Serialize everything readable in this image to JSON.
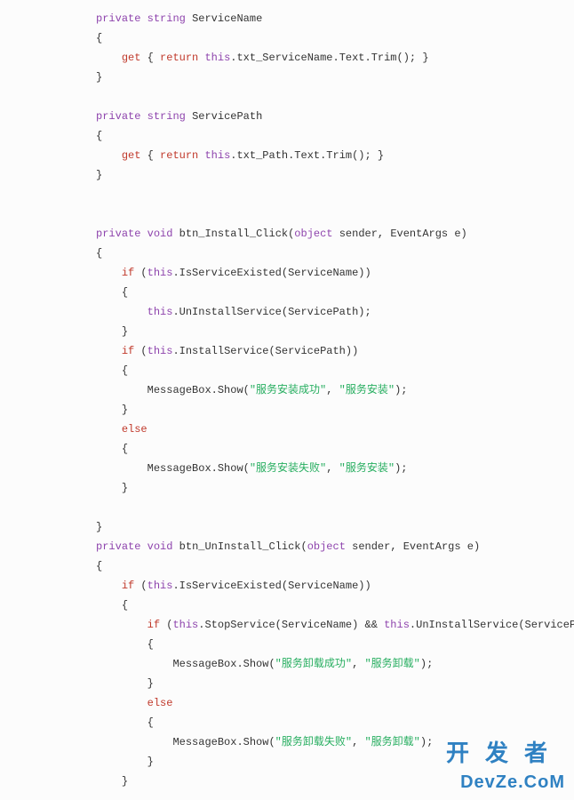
{
  "code": {
    "lines": [
      {
        "indent": 8,
        "tokens": [
          {
            "t": "private",
            "c": "kw"
          },
          {
            "t": " "
          },
          {
            "t": "string",
            "c": "kw"
          },
          {
            "t": " ServiceName"
          }
        ]
      },
      {
        "indent": 8,
        "tokens": [
          {
            "t": "{"
          }
        ]
      },
      {
        "indent": 12,
        "tokens": [
          {
            "t": "get",
            "c": "kw2"
          },
          {
            "t": " { "
          },
          {
            "t": "return",
            "c": "kw2"
          },
          {
            "t": " "
          },
          {
            "t": "this",
            "c": "kw"
          },
          {
            "t": ".txt_ServiceName.Text.Trim(); }"
          }
        ]
      },
      {
        "indent": 8,
        "tokens": [
          {
            "t": "}"
          }
        ]
      },
      {
        "indent": 8,
        "tokens": []
      },
      {
        "indent": 8,
        "tokens": [
          {
            "t": "private",
            "c": "kw"
          },
          {
            "t": " "
          },
          {
            "t": "string",
            "c": "kw"
          },
          {
            "t": " ServicePath"
          }
        ]
      },
      {
        "indent": 8,
        "tokens": [
          {
            "t": "{"
          }
        ]
      },
      {
        "indent": 12,
        "tokens": [
          {
            "t": "get",
            "c": "kw2"
          },
          {
            "t": " { "
          },
          {
            "t": "return",
            "c": "kw2"
          },
          {
            "t": " "
          },
          {
            "t": "this",
            "c": "kw"
          },
          {
            "t": ".txt_Path.Text.Trim(); }"
          }
        ]
      },
      {
        "indent": 8,
        "tokens": [
          {
            "t": "}"
          }
        ]
      },
      {
        "indent": 8,
        "tokens": []
      },
      {
        "indent": 8,
        "tokens": []
      },
      {
        "indent": 8,
        "tokens": [
          {
            "t": "private",
            "c": "kw"
          },
          {
            "t": " "
          },
          {
            "t": "void",
            "c": "kw"
          },
          {
            "t": " btn_Install_Click("
          },
          {
            "t": "object",
            "c": "kw"
          },
          {
            "t": " sender, EventArgs e)"
          }
        ]
      },
      {
        "indent": 8,
        "tokens": [
          {
            "t": "{"
          }
        ]
      },
      {
        "indent": 12,
        "tokens": [
          {
            "t": "if",
            "c": "kw2"
          },
          {
            "t": " ("
          },
          {
            "t": "this",
            "c": "kw"
          },
          {
            "t": ".IsServiceExisted(ServiceName))"
          }
        ]
      },
      {
        "indent": 12,
        "tokens": [
          {
            "t": "{"
          }
        ]
      },
      {
        "indent": 16,
        "tokens": [
          {
            "t": "this",
            "c": "kw"
          },
          {
            "t": ".UnInstallService(ServicePath);"
          }
        ]
      },
      {
        "indent": 12,
        "tokens": [
          {
            "t": "}"
          }
        ]
      },
      {
        "indent": 12,
        "tokens": [
          {
            "t": "if",
            "c": "kw2"
          },
          {
            "t": " ("
          },
          {
            "t": "this",
            "c": "kw"
          },
          {
            "t": ".InstallService(ServicePath))"
          }
        ]
      },
      {
        "indent": 12,
        "tokens": [
          {
            "t": "{"
          }
        ]
      },
      {
        "indent": 16,
        "tokens": [
          {
            "t": "MessageBox.Show("
          },
          {
            "t": "\"服务安装成功\"",
            "c": "str"
          },
          {
            "t": ", "
          },
          {
            "t": "\"服务安装\"",
            "c": "str"
          },
          {
            "t": ");"
          }
        ]
      },
      {
        "indent": 12,
        "tokens": [
          {
            "t": "}"
          }
        ]
      },
      {
        "indent": 12,
        "tokens": [
          {
            "t": "else",
            "c": "kw2"
          }
        ]
      },
      {
        "indent": 12,
        "tokens": [
          {
            "t": "{"
          }
        ]
      },
      {
        "indent": 16,
        "tokens": [
          {
            "t": "MessageBox.Show("
          },
          {
            "t": "\"服务安装失败\"",
            "c": "str"
          },
          {
            "t": ", "
          },
          {
            "t": "\"服务安装\"",
            "c": "str"
          },
          {
            "t": ");"
          }
        ]
      },
      {
        "indent": 12,
        "tokens": [
          {
            "t": "}"
          }
        ]
      },
      {
        "indent": 12,
        "tokens": []
      },
      {
        "indent": 8,
        "tokens": [
          {
            "t": "}"
          }
        ]
      },
      {
        "indent": 8,
        "tokens": [
          {
            "t": "private",
            "c": "kw"
          },
          {
            "t": " "
          },
          {
            "t": "void",
            "c": "kw"
          },
          {
            "t": " btn_UnInstall_Click("
          },
          {
            "t": "object",
            "c": "kw"
          },
          {
            "t": " sender, EventArgs e)"
          }
        ]
      },
      {
        "indent": 8,
        "tokens": [
          {
            "t": "{"
          }
        ]
      },
      {
        "indent": 12,
        "tokens": [
          {
            "t": "if",
            "c": "kw2"
          },
          {
            "t": " ("
          },
          {
            "t": "this",
            "c": "kw"
          },
          {
            "t": ".IsServiceExisted(ServiceName))"
          }
        ]
      },
      {
        "indent": 12,
        "tokens": [
          {
            "t": "{"
          }
        ]
      },
      {
        "indent": 16,
        "tokens": [
          {
            "t": "if",
            "c": "kw2"
          },
          {
            "t": " ("
          },
          {
            "t": "this",
            "c": "kw"
          },
          {
            "t": ".StopService(ServiceName) && "
          },
          {
            "t": "this",
            "c": "kw"
          },
          {
            "t": ".UnInstallService(ServicePath))"
          }
        ]
      },
      {
        "indent": 16,
        "tokens": [
          {
            "t": "{"
          }
        ]
      },
      {
        "indent": 20,
        "tokens": [
          {
            "t": "MessageBox.Show("
          },
          {
            "t": "\"服务卸载成功\"",
            "c": "str"
          },
          {
            "t": ", "
          },
          {
            "t": "\"服务卸载\"",
            "c": "str"
          },
          {
            "t": ");"
          }
        ]
      },
      {
        "indent": 16,
        "tokens": [
          {
            "t": "}"
          }
        ]
      },
      {
        "indent": 16,
        "tokens": [
          {
            "t": "else",
            "c": "kw2"
          }
        ]
      },
      {
        "indent": 16,
        "tokens": [
          {
            "t": "{"
          }
        ]
      },
      {
        "indent": 20,
        "tokens": [
          {
            "t": "MessageBox.Show("
          },
          {
            "t": "\"服务卸载失败\"",
            "c": "str"
          },
          {
            "t": ", "
          },
          {
            "t": "\"服务卸载\"",
            "c": "str"
          },
          {
            "t": ");"
          }
        ]
      },
      {
        "indent": 16,
        "tokens": [
          {
            "t": "}"
          }
        ]
      },
      {
        "indent": 12,
        "tokens": [
          {
            "t": "}"
          }
        ]
      }
    ]
  },
  "watermark": {
    "cn": "开发者",
    "en": "DevZe.CoM"
  },
  "indent_char": " ",
  "base_indent": 8
}
